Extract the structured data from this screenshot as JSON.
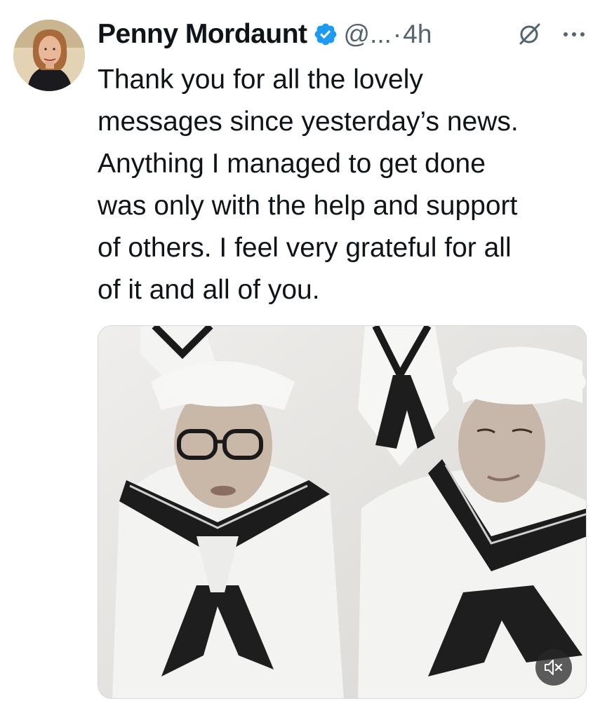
{
  "author": {
    "display_name": "Penny Mordaunt",
    "handle": "@...",
    "separator": "·",
    "time": "4h"
  },
  "tweet": {
    "lines": [
      "Thank you for all the lovely",
      "messages since yesterday’s news.",
      "Anything I managed to get done",
      "was only with the help and support",
      "of others. I feel very grateful for all",
      "of it and all of you."
    ]
  },
  "colors": {
    "verified_blue": "#1d9bf0",
    "secondary_text": "#536471",
    "primary_text": "#0f1419"
  },
  "icons": {
    "verified": "verified-badge-icon",
    "grok": "grok-icon",
    "more": "more-icon",
    "mute": "mute-icon"
  }
}
